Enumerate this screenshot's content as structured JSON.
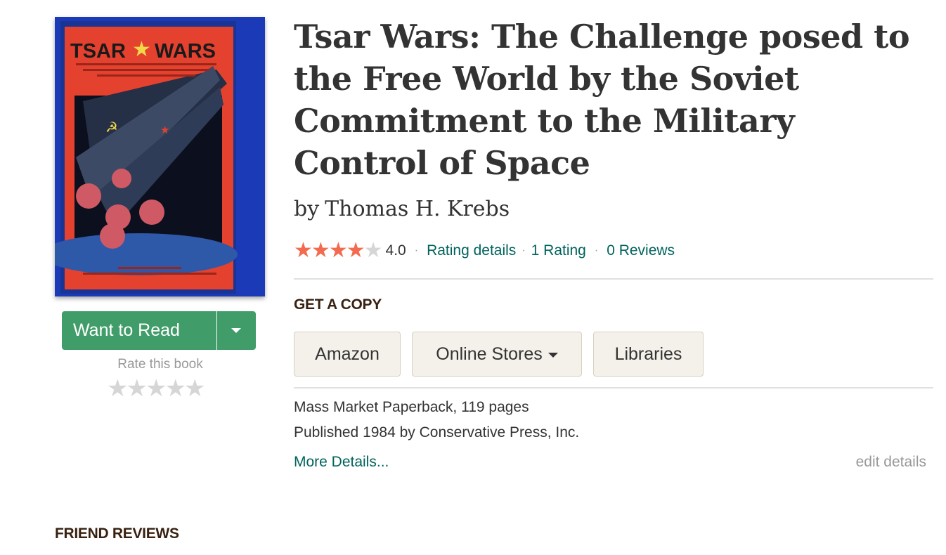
{
  "book": {
    "title": "Tsar Wars: The Challenge posed to the Free World by the Soviet Commitment to the Military Control of Space",
    "by_label": "by",
    "author": "Thomas H. Krebs",
    "rating_value": 4,
    "rating_max": 5,
    "average_rating": "4.0",
    "rating_details_label": "Rating details",
    "ratings_count_label": "1 Rating",
    "reviews_count_label": "0 Reviews"
  },
  "cover": {
    "alt": "Tsar Wars book cover",
    "title_left": "TSAR",
    "title_right": "WARS",
    "background_color": "#1b3ab8",
    "book_color": "#e5412f"
  },
  "shelf": {
    "want_to_read_label": "Want to Read",
    "dropdown_icon": "caret-down-icon",
    "rate_label": "Rate this book",
    "rate_stars": 5
  },
  "get_copy": {
    "heading": "GET A COPY",
    "stores": [
      {
        "label": "Amazon"
      },
      {
        "label": "Online Stores",
        "has_dropdown": true
      },
      {
        "label": "Libraries"
      }
    ]
  },
  "details": {
    "format_line": "Mass Market Paperback, 119 pages",
    "published_line": "Published 1984 by Conservative Press, Inc.",
    "more_details_label": "More Details...",
    "edit_details_label": "edit details"
  },
  "friend_reviews": {
    "heading": "FRIEND REVIEWS"
  },
  "colors": {
    "accent_green": "#409d69",
    "link_teal": "#00635d",
    "star_orange": "#f26b4f",
    "heading_brown": "#382110",
    "button_beige": "#f4f1ea"
  }
}
